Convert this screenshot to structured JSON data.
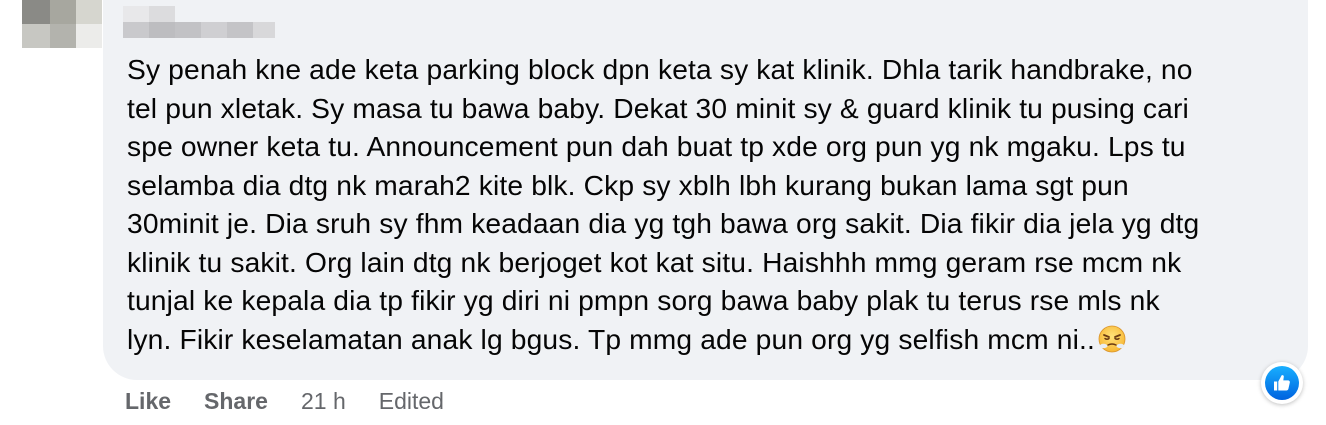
{
  "comment": {
    "text": "Sy penah kne ade keta parking block dpn keta sy kat klinik. Dhla tarik handbrake, no\ntel pun xletak. Sy masa tu bawa baby. Dekat 30 minit sy & guard klinik tu pusing cari\nspe owner keta tu. Announcement pun dah buat tp xde org pun yg nk mgaku. Lps tu\nselamba dia dtg nk marah2 kite blk. Ckp sy xblh lbh kurang bukan lama sgt pun\n30minit je. Dia sruh sy fhm keadaan dia yg tgh bawa org sakit. Dia fikir dia jela yg dtg\nklinik tu sakit. Org lain dtg nk berjoget kot kat situ. Haishhh mmg geram rse mcm nk\ntunjal ke kepala dia tp fikir yg diri ni pmpn sorg bawa baby plak tu terus rse mls nk\nlyn. Fikir keselamatan anak lg bgus. Tp mmg ade pun org yg selfish mcm ni..",
    "emoji": "huffing-face-emoji",
    "reaction": "like-reaction-icon"
  },
  "actions": {
    "like_label": "Like",
    "share_label": "Share",
    "timestamp": "21 h",
    "edited_label": "Edited"
  },
  "colors": {
    "bubble_bg": "#f0f2f5",
    "text": "#050505",
    "secondary_text": "#65676b",
    "like_blue": "#0866ff"
  }
}
